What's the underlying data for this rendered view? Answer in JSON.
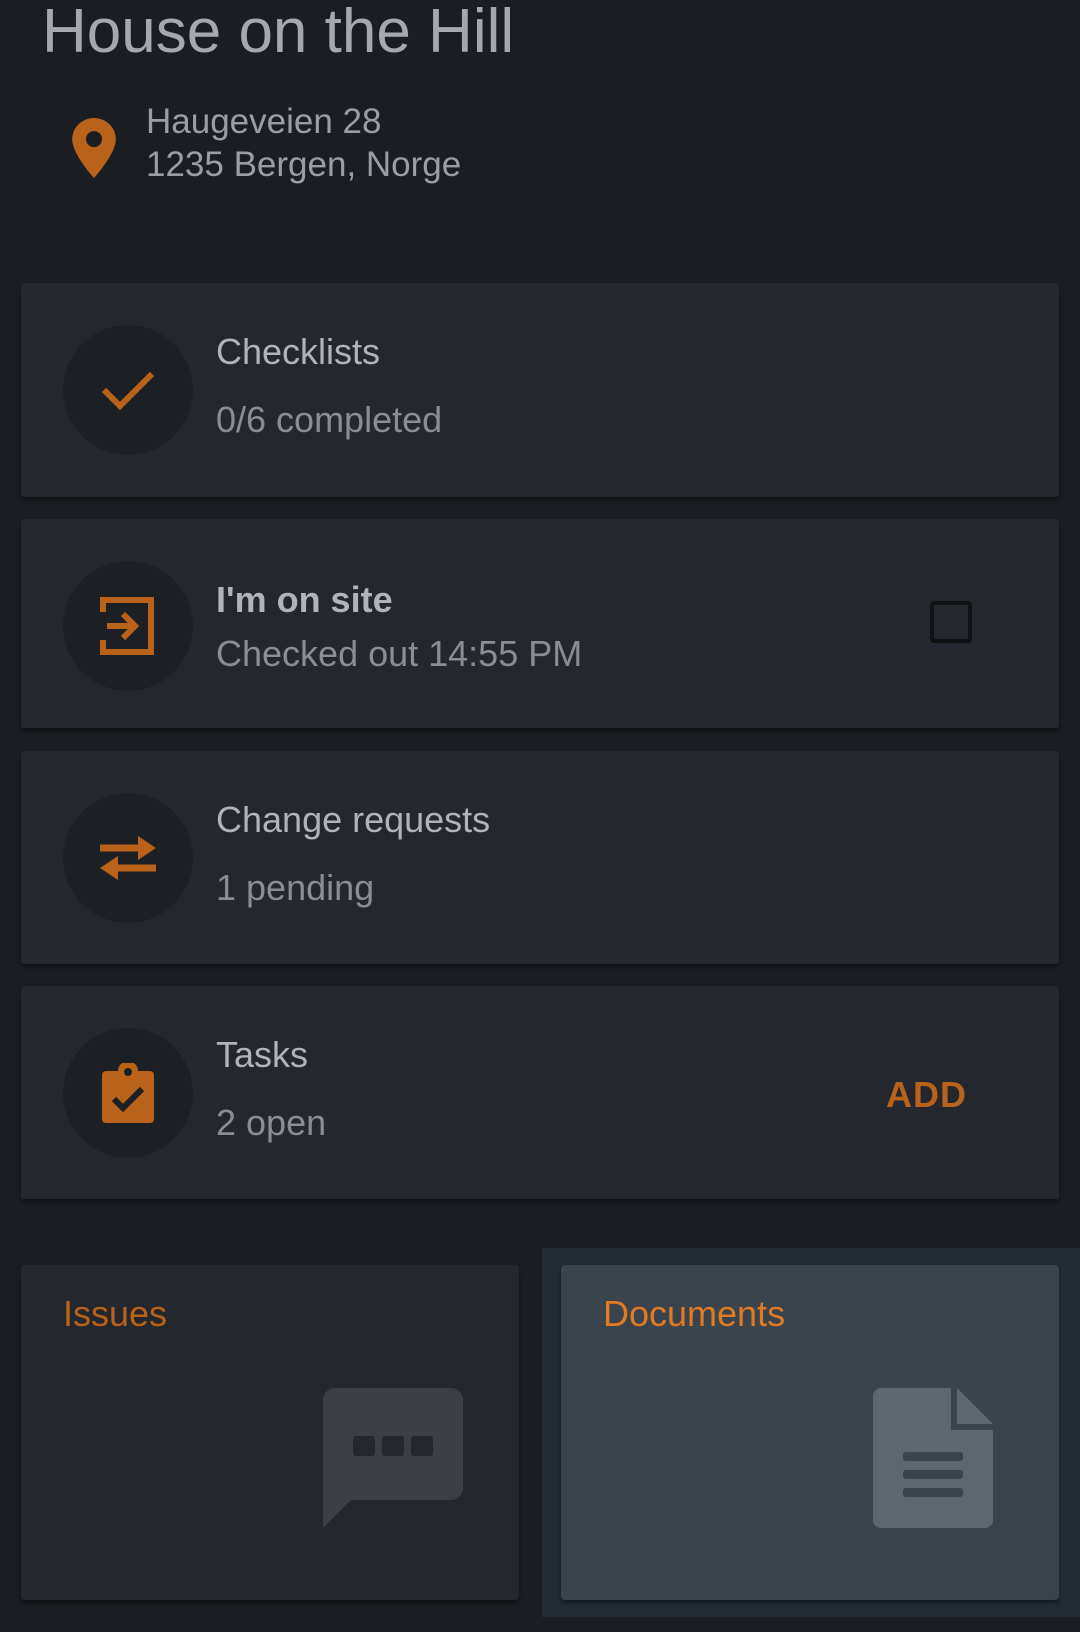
{
  "project": {
    "title": "House on the Hill",
    "address_line1": "Haugeveien 28",
    "address_line2": "1235 Bergen, Norge"
  },
  "cards": {
    "checklists": {
      "title": "Checklists",
      "subtitle": "0/6 completed",
      "icon": "check-icon"
    },
    "onsite": {
      "title": "I'm on site",
      "subtitle": "Checked out 14:55 PM",
      "icon": "sign-in-icon",
      "checked": false
    },
    "change_requests": {
      "title": "Change requests",
      "subtitle": "1 pending",
      "icon": "swap-arrows-icon"
    },
    "tasks": {
      "title": "Tasks",
      "subtitle": "2 open",
      "add_label": "ADD",
      "icon": "clipboard-check-icon"
    }
  },
  "tiles": {
    "issues": {
      "label": "Issues",
      "icon": "chat-bubble-icon"
    },
    "documents": {
      "label": "Documents",
      "icon": "document-icon"
    }
  },
  "colors": {
    "accent": "#b8621a",
    "background": "#1a1e23",
    "card": "#24282e"
  }
}
